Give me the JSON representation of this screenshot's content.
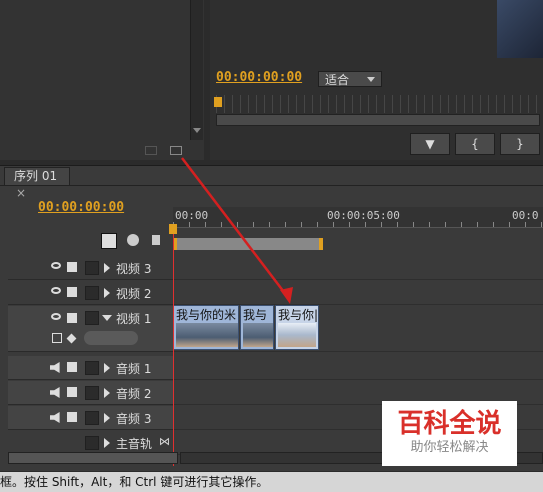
{
  "monitor": {
    "timecode": "00:00:00:00",
    "fit_label": "适合",
    "marker_btn": "▼",
    "in_btn": "{",
    "out_btn": "}"
  },
  "sequence": {
    "tab_label": "序列 01",
    "tab_close": "×",
    "timecode": "00:00:00:00",
    "ruler_labels": [
      "00:00",
      "00:00:05:00",
      "00:0"
    ]
  },
  "tracks": {
    "video": [
      "视频 3",
      "视频 2",
      "视频 1"
    ],
    "audio": [
      "音频 1",
      "音频 2",
      "音频 3"
    ],
    "master": "主音轨"
  },
  "clips": [
    "我与你的米",
    "我与",
    "我与你|"
  ],
  "status_bar": "框。按住 Shift，Alt，和 Ctrl 键可进行其它操作。",
  "watermark": {
    "title": "百科全说",
    "subtitle": "助你轻松解决"
  },
  "colors": {
    "accent": "#e0a020",
    "playhead": "#e03030",
    "watermark_red": "#d9302a"
  }
}
